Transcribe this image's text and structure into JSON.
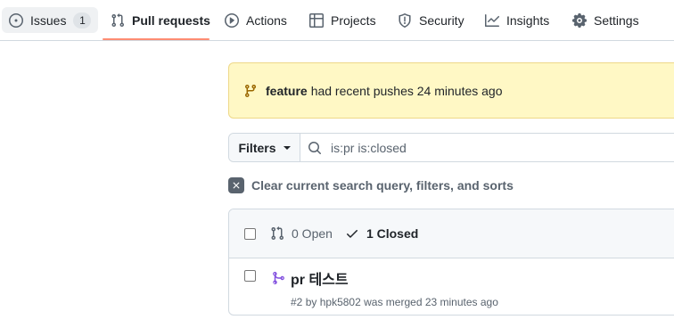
{
  "tabs": [
    {
      "label": "Issues",
      "icon": "issue-opened-icon",
      "count": "1"
    },
    {
      "label": "Pull requests",
      "icon": "git-pull-request-icon"
    },
    {
      "label": "Actions",
      "icon": "play-icon"
    },
    {
      "label": "Projects",
      "icon": "table-icon"
    },
    {
      "label": "Security",
      "icon": "shield-icon"
    },
    {
      "label": "Insights",
      "icon": "graph-icon"
    },
    {
      "label": "Settings",
      "icon": "gear-icon"
    }
  ],
  "banner": {
    "branch": "feature",
    "message": "had recent pushes 24 minutes ago"
  },
  "filter_bar": {
    "filters_label": "Filters",
    "query": "is:pr is:closed"
  },
  "clear_label": "Clear current search query, filters, and sorts",
  "list": {
    "open_label": "0 Open",
    "closed_label": "1 Closed",
    "items": [
      {
        "title": "pr 테스트",
        "number": "#2",
        "by": "by",
        "author": "hpk5802",
        "status": "was merged 23 minutes ago"
      }
    ]
  },
  "colors": {
    "accent_underline": "#fd8c73",
    "merged": "#8250df",
    "banner_bg": "#fff8c5"
  }
}
